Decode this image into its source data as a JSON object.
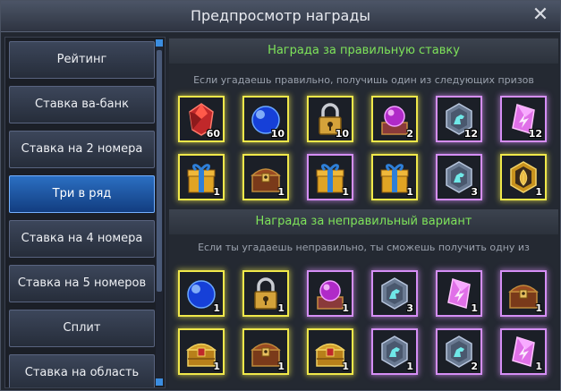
{
  "window": {
    "title": "Предпросмотр награды"
  },
  "menu": [
    {
      "label": "Рейтинг",
      "active": false
    },
    {
      "label": "Ставка ва-банк",
      "active": false
    },
    {
      "label": "Ставка на 2 номера",
      "active": false
    },
    {
      "label": "Три в ряд",
      "active": true
    },
    {
      "label": "Ставка на 4 номера",
      "active": false
    },
    {
      "label": "Ставка на 5 номеров",
      "active": false
    },
    {
      "label": "Сплит",
      "active": false
    },
    {
      "label": "Ставка на область",
      "active": false
    }
  ],
  "correct": {
    "header": "Награда за правильную ставку",
    "description": "Если угадаешь правильно, получишь один из следующих призов",
    "items": [
      {
        "icon": "red-gem-icon",
        "qty": "60",
        "frame": "yellow"
      },
      {
        "icon": "blue-orb-icon",
        "qty": "10",
        "frame": "yellow"
      },
      {
        "icon": "padlock-icon",
        "qty": "10",
        "frame": "yellow"
      },
      {
        "icon": "crystal-ball-chest-icon",
        "qty": "2",
        "frame": "yellow"
      },
      {
        "icon": "horse-emblem-icon",
        "qty": "12",
        "frame": "purple"
      },
      {
        "icon": "pink-crystal-icon",
        "qty": "12",
        "frame": "purple"
      },
      {
        "icon": "gift-box-icon",
        "qty": "1",
        "frame": "yellow"
      },
      {
        "icon": "treasure-chest-icon",
        "qty": "1",
        "frame": "yellow"
      },
      {
        "icon": "gift-box-icon",
        "qty": "1",
        "frame": "purple"
      },
      {
        "icon": "gift-box-icon",
        "qty": "1",
        "frame": "yellow"
      },
      {
        "icon": "horse-emblem-icon",
        "qty": "3",
        "frame": "purple"
      },
      {
        "icon": "gold-badge-icon",
        "qty": "1",
        "frame": "yellow"
      }
    ]
  },
  "incorrect": {
    "header": "Награда за неправильный вариант",
    "description": "Если ты угадаешь неправильно, ты сможешь получить одну из",
    "items": [
      {
        "icon": "blue-orb-icon",
        "qty": "1",
        "frame": "yellow"
      },
      {
        "icon": "padlock-icon",
        "qty": "1",
        "frame": "yellow"
      },
      {
        "icon": "crystal-ball-chest-icon",
        "qty": "1",
        "frame": "purple"
      },
      {
        "icon": "horse-emblem-icon",
        "qty": "3",
        "frame": "purple"
      },
      {
        "icon": "pink-crystal-icon",
        "qty": "1",
        "frame": "purple"
      },
      {
        "icon": "treasure-chest-icon",
        "qty": "1",
        "frame": "purple"
      },
      {
        "icon": "golden-chest-icon",
        "qty": "1",
        "frame": "yellow"
      },
      {
        "icon": "treasure-chest-icon",
        "qty": "1",
        "frame": "yellow"
      },
      {
        "icon": "golden-chest-icon",
        "qty": "1",
        "frame": "yellow"
      },
      {
        "icon": "horse-emblem-icon",
        "qty": "1",
        "frame": "purple"
      },
      {
        "icon": "horse-emblem-icon",
        "qty": "2",
        "frame": "purple"
      },
      {
        "icon": "pink-crystal-icon",
        "qty": "1",
        "frame": "purple"
      }
    ]
  },
  "colors": {
    "header_text": "#7ee35a",
    "frame_yellow": "#f0e84a",
    "frame_purple": "#d58ef5",
    "active_tab": "#2b6fc2"
  }
}
